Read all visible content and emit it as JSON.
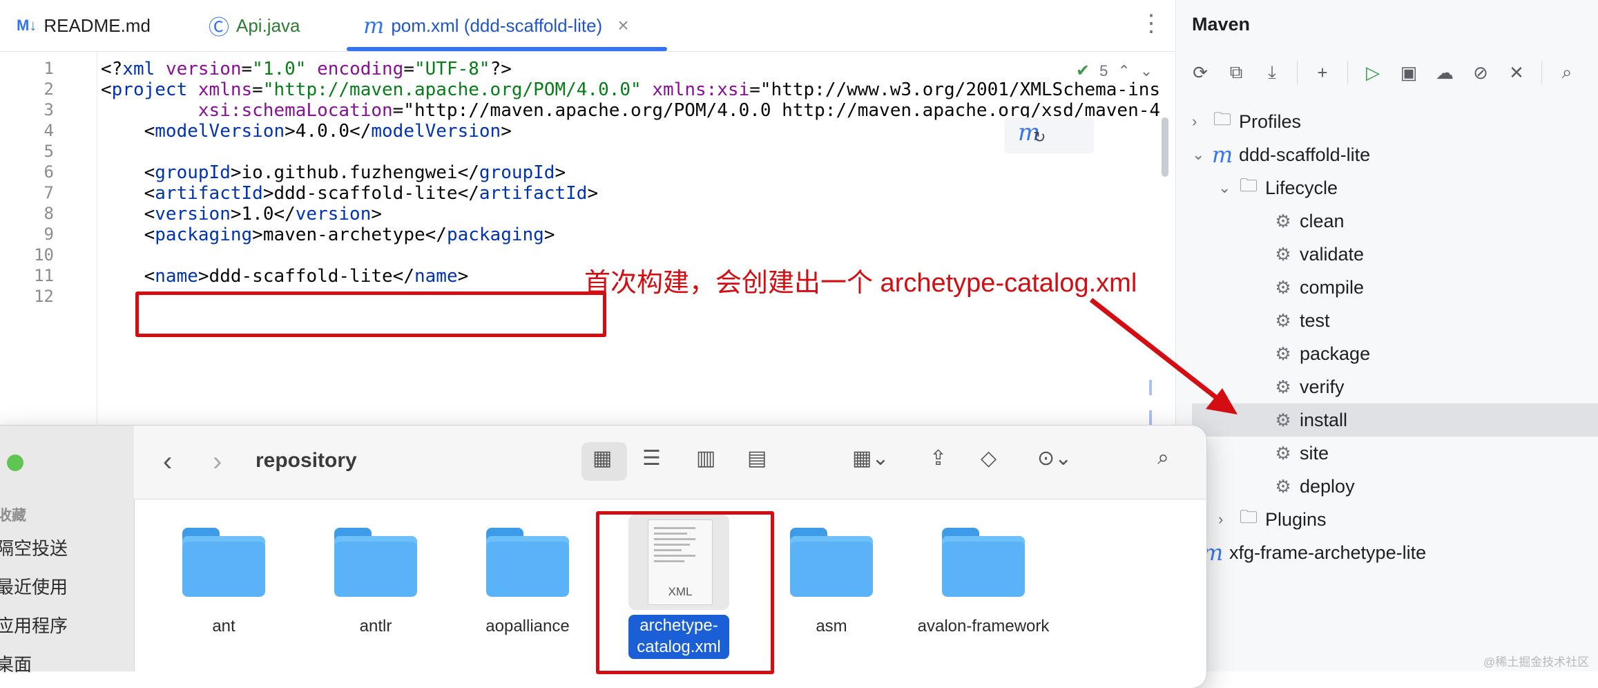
{
  "tabs": {
    "readme": {
      "icon": "M↓",
      "label": "README.md"
    },
    "api": {
      "icon": "Ⓒ",
      "label": "Api.java"
    },
    "pom": {
      "icon": "m",
      "label": "pom.xml (ddd-scaffold-lite)",
      "close": "×"
    },
    "more": "⋮"
  },
  "editor": {
    "inspection_count": "5",
    "line_numbers": [
      "1",
      "2",
      "3",
      "4",
      "5",
      "6",
      "7",
      "8",
      "9",
      "10",
      "11",
      "12"
    ],
    "lines": [
      "<?xml version=\"1.0\" encoding=\"UTF-8\"?>",
      "<project xmlns=\"http://maven.apache.org/POM/4.0.0\" xmlns:xsi=\"http://www.w3.org/2001/XMLSchema-ins",
      "         xsi:schemaLocation=\"http://maven.apache.org/POM/4.0.0 http://maven.apache.org/xsd/maven-4",
      "    <modelVersion>4.0.0</modelVersion>",
      "",
      "    <groupId>io.github.fuzhengwei</groupId>",
      "    <artifactId>ddd-scaffold-lite</artifactId>",
      "    <version>1.0</version>",
      "    <packaging>maven-archetype</packaging>",
      "",
      "    <name>ddd-scaffold-lite</name>",
      ""
    ]
  },
  "annotation": {
    "text": "首次构建，会创建出一个 archetype-catalog.xml",
    "color": "#d40d12"
  },
  "maven": {
    "title": "Maven",
    "tree": {
      "profiles": "Profiles",
      "project": "ddd-scaffold-lite",
      "lifecycle": "Lifecycle",
      "phases": [
        "clean",
        "validate",
        "compile",
        "test",
        "package",
        "verify",
        "install",
        "site",
        "deploy"
      ],
      "selected_phase": "install",
      "plugins": "Plugins",
      "other_project": "xfg-frame-archetype-lite"
    }
  },
  "finder": {
    "title": "repository",
    "sidebar": {
      "heading": "收藏",
      "items": [
        "隔空投送",
        "最近使用",
        "应用程序",
        "桌面"
      ]
    },
    "items": [
      "ant",
      "antlr",
      "aopalliance",
      "archetype-catalog.xml",
      "asm",
      "avalon-framework"
    ],
    "selected_item": "archetype-catalog.xml",
    "file_badge": "XML",
    "selected_name_lines": [
      "archetype-",
      "catalog.xml"
    ]
  },
  "watermark": "@稀土掘金技术社区",
  "colors": {
    "accent": "#3574f0",
    "annotation_red": "#d40d12",
    "selection_blue": "#1a5fd6"
  }
}
